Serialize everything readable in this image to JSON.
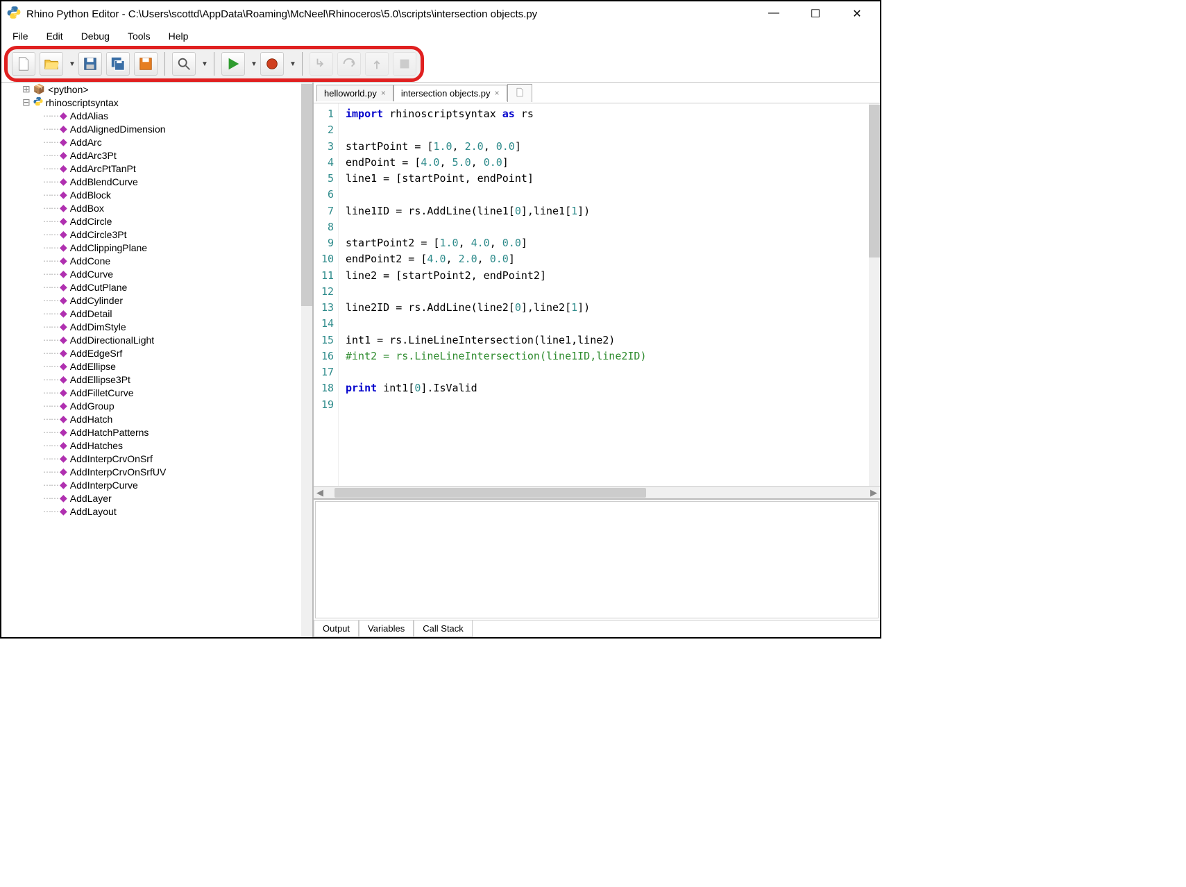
{
  "title": "Rhino Python Editor - C:\\Users\\scottd\\AppData\\Roaming\\McNeel\\Rhinoceros\\5.0\\scripts\\intersection objects.py",
  "menu": [
    "File",
    "Edit",
    "Debug",
    "Tools",
    "Help"
  ],
  "sidebar": {
    "root": "rhinoscriptsyntax",
    "python_root": "<python>",
    "items": [
      "AddAlias",
      "AddAlignedDimension",
      "AddArc",
      "AddArc3Pt",
      "AddArcPtTanPt",
      "AddBlendCurve",
      "AddBlock",
      "AddBox",
      "AddCircle",
      "AddCircle3Pt",
      "AddClippingPlane",
      "AddCone",
      "AddCurve",
      "AddCutPlane",
      "AddCylinder",
      "AddDetail",
      "AddDimStyle",
      "AddDirectionalLight",
      "AddEdgeSrf",
      "AddEllipse",
      "AddEllipse3Pt",
      "AddFilletCurve",
      "AddGroup",
      "AddHatch",
      "AddHatchPatterns",
      "AddHatches",
      "AddInterpCrvOnSrf",
      "AddInterpCrvOnSrfUV",
      "AddInterpCurve",
      "AddLayer",
      "AddLayout"
    ]
  },
  "tabs": [
    {
      "label": "helloworld.py",
      "active": false
    },
    {
      "label": "intersection objects.py",
      "active": true
    }
  ],
  "code_lines": [
    {
      "n": 1,
      "html": "<span class='kw-blue'>import</span> <span class='kw-black'>rhinoscriptsyntax</span> <span class='kw-blue'>as</span> <span class='kw-black'>rs</span>"
    },
    {
      "n": 2,
      "html": ""
    },
    {
      "n": 3,
      "html": "<span class='kw-black'>startPoint = [</span><span class='kw-num'>1.0</span><span class='kw-black'>, </span><span class='kw-num'>2.0</span><span class='kw-black'>, </span><span class='kw-num'>0.0</span><span class='kw-black'>]</span>"
    },
    {
      "n": 4,
      "html": "<span class='kw-black'>endPoint = [</span><span class='kw-num'>4.0</span><span class='kw-black'>, </span><span class='kw-num'>5.0</span><span class='kw-black'>, </span><span class='kw-num'>0.0</span><span class='kw-black'>]</span>"
    },
    {
      "n": 5,
      "html": "<span class='kw-black'>line1 = [startPoint, endPoint]</span>"
    },
    {
      "n": 6,
      "html": ""
    },
    {
      "n": 7,
      "html": "<span class='kw-black'>line1ID = rs.AddLine(line1[</span><span class='kw-num'>0</span><span class='kw-black'>],line1[</span><span class='kw-num'>1</span><span class='kw-black'>])</span>"
    },
    {
      "n": 8,
      "html": ""
    },
    {
      "n": 9,
      "html": "<span class='kw-black'>startPoint2 = [</span><span class='kw-num'>1.0</span><span class='kw-black'>, </span><span class='kw-num'>4.0</span><span class='kw-black'>, </span><span class='kw-num'>0.0</span><span class='kw-black'>]</span>"
    },
    {
      "n": 10,
      "html": "<span class='kw-black'>endPoint2 = [</span><span class='kw-num'>4.0</span><span class='kw-black'>, </span><span class='kw-num'>2.0</span><span class='kw-black'>, </span><span class='kw-num'>0.0</span><span class='kw-black'>]</span>"
    },
    {
      "n": 11,
      "html": "<span class='kw-black'>line2 = [startPoint2, endPoint2]</span>"
    },
    {
      "n": 12,
      "html": ""
    },
    {
      "n": 13,
      "html": "<span class='kw-black'>line2ID = rs.AddLine(line2[</span><span class='kw-num'>0</span><span class='kw-black'>],line2[</span><span class='kw-num'>1</span><span class='kw-black'>])</span>"
    },
    {
      "n": 14,
      "html": ""
    },
    {
      "n": 15,
      "html": "<span class='kw-black'>int1 = rs.LineLineIntersection(line1,line2)</span>"
    },
    {
      "n": 16,
      "html": "<span class='kw-comment'>#int2 = rs.LineLineIntersection(line1ID,line2ID)</span>"
    },
    {
      "n": 17,
      "html": ""
    },
    {
      "n": 18,
      "html": "<span class='kw-blue'>print</span> <span class='kw-black'>int1[</span><span class='kw-num'>0</span><span class='kw-black'>].IsValid</span>"
    },
    {
      "n": 19,
      "html": ""
    }
  ],
  "output_tabs": [
    "Output",
    "Variables",
    "Call Stack"
  ]
}
